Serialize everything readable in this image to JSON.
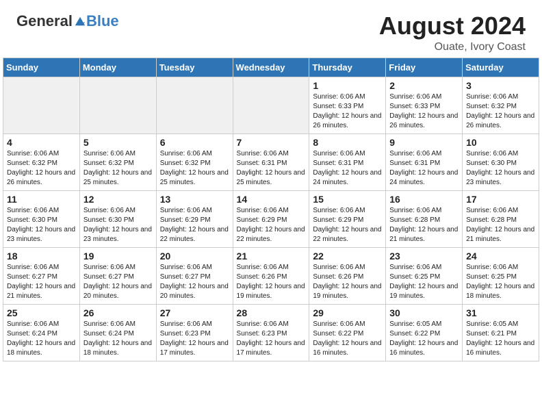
{
  "header": {
    "logo": {
      "general": "General",
      "blue": "Blue"
    },
    "title": "August 2024",
    "subtitle": "Ouate, Ivory Coast"
  },
  "days_of_week": [
    "Sunday",
    "Monday",
    "Tuesday",
    "Wednesday",
    "Thursday",
    "Friday",
    "Saturday"
  ],
  "weeks": [
    [
      {
        "day": "",
        "empty": true
      },
      {
        "day": "",
        "empty": true
      },
      {
        "day": "",
        "empty": true
      },
      {
        "day": "",
        "empty": true
      },
      {
        "day": "1",
        "sunrise": "Sunrise: 6:06 AM",
        "sunset": "Sunset: 6:33 PM",
        "daylight": "Daylight: 12 hours and 26 minutes."
      },
      {
        "day": "2",
        "sunrise": "Sunrise: 6:06 AM",
        "sunset": "Sunset: 6:33 PM",
        "daylight": "Daylight: 12 hours and 26 minutes."
      },
      {
        "day": "3",
        "sunrise": "Sunrise: 6:06 AM",
        "sunset": "Sunset: 6:32 PM",
        "daylight": "Daylight: 12 hours and 26 minutes."
      }
    ],
    [
      {
        "day": "4",
        "sunrise": "Sunrise: 6:06 AM",
        "sunset": "Sunset: 6:32 PM",
        "daylight": "Daylight: 12 hours and 26 minutes."
      },
      {
        "day": "5",
        "sunrise": "Sunrise: 6:06 AM",
        "sunset": "Sunset: 6:32 PM",
        "daylight": "Daylight: 12 hours and 25 minutes."
      },
      {
        "day": "6",
        "sunrise": "Sunrise: 6:06 AM",
        "sunset": "Sunset: 6:32 PM",
        "daylight": "Daylight: 12 hours and 25 minutes."
      },
      {
        "day": "7",
        "sunrise": "Sunrise: 6:06 AM",
        "sunset": "Sunset: 6:31 PM",
        "daylight": "Daylight: 12 hours and 25 minutes."
      },
      {
        "day": "8",
        "sunrise": "Sunrise: 6:06 AM",
        "sunset": "Sunset: 6:31 PM",
        "daylight": "Daylight: 12 hours and 24 minutes."
      },
      {
        "day": "9",
        "sunrise": "Sunrise: 6:06 AM",
        "sunset": "Sunset: 6:31 PM",
        "daylight": "Daylight: 12 hours and 24 minutes."
      },
      {
        "day": "10",
        "sunrise": "Sunrise: 6:06 AM",
        "sunset": "Sunset: 6:30 PM",
        "daylight": "Daylight: 12 hours and 23 minutes."
      }
    ],
    [
      {
        "day": "11",
        "sunrise": "Sunrise: 6:06 AM",
        "sunset": "Sunset: 6:30 PM",
        "daylight": "Daylight: 12 hours and 23 minutes."
      },
      {
        "day": "12",
        "sunrise": "Sunrise: 6:06 AM",
        "sunset": "Sunset: 6:30 PM",
        "daylight": "Daylight: 12 hours and 23 minutes."
      },
      {
        "day": "13",
        "sunrise": "Sunrise: 6:06 AM",
        "sunset": "Sunset: 6:29 PM",
        "daylight": "Daylight: 12 hours and 22 minutes."
      },
      {
        "day": "14",
        "sunrise": "Sunrise: 6:06 AM",
        "sunset": "Sunset: 6:29 PM",
        "daylight": "Daylight: 12 hours and 22 minutes."
      },
      {
        "day": "15",
        "sunrise": "Sunrise: 6:06 AM",
        "sunset": "Sunset: 6:29 PM",
        "daylight": "Daylight: 12 hours and 22 minutes."
      },
      {
        "day": "16",
        "sunrise": "Sunrise: 6:06 AM",
        "sunset": "Sunset: 6:28 PM",
        "daylight": "Daylight: 12 hours and 21 minutes."
      },
      {
        "day": "17",
        "sunrise": "Sunrise: 6:06 AM",
        "sunset": "Sunset: 6:28 PM",
        "daylight": "Daylight: 12 hours and 21 minutes."
      }
    ],
    [
      {
        "day": "18",
        "sunrise": "Sunrise: 6:06 AM",
        "sunset": "Sunset: 6:27 PM",
        "daylight": "Daylight: 12 hours and 21 minutes."
      },
      {
        "day": "19",
        "sunrise": "Sunrise: 6:06 AM",
        "sunset": "Sunset: 6:27 PM",
        "daylight": "Daylight: 12 hours and 20 minutes."
      },
      {
        "day": "20",
        "sunrise": "Sunrise: 6:06 AM",
        "sunset": "Sunset: 6:27 PM",
        "daylight": "Daylight: 12 hours and 20 minutes."
      },
      {
        "day": "21",
        "sunrise": "Sunrise: 6:06 AM",
        "sunset": "Sunset: 6:26 PM",
        "daylight": "Daylight: 12 hours and 19 minutes."
      },
      {
        "day": "22",
        "sunrise": "Sunrise: 6:06 AM",
        "sunset": "Sunset: 6:26 PM",
        "daylight": "Daylight: 12 hours and 19 minutes."
      },
      {
        "day": "23",
        "sunrise": "Sunrise: 6:06 AM",
        "sunset": "Sunset: 6:25 PM",
        "daylight": "Daylight: 12 hours and 19 minutes."
      },
      {
        "day": "24",
        "sunrise": "Sunrise: 6:06 AM",
        "sunset": "Sunset: 6:25 PM",
        "daylight": "Daylight: 12 hours and 18 minutes."
      }
    ],
    [
      {
        "day": "25",
        "sunrise": "Sunrise: 6:06 AM",
        "sunset": "Sunset: 6:24 PM",
        "daylight": "Daylight: 12 hours and 18 minutes."
      },
      {
        "day": "26",
        "sunrise": "Sunrise: 6:06 AM",
        "sunset": "Sunset: 6:24 PM",
        "daylight": "Daylight: 12 hours and 18 minutes."
      },
      {
        "day": "27",
        "sunrise": "Sunrise: 6:06 AM",
        "sunset": "Sunset: 6:23 PM",
        "daylight": "Daylight: 12 hours and 17 minutes."
      },
      {
        "day": "28",
        "sunrise": "Sunrise: 6:06 AM",
        "sunset": "Sunset: 6:23 PM",
        "daylight": "Daylight: 12 hours and 17 minutes."
      },
      {
        "day": "29",
        "sunrise": "Sunrise: 6:06 AM",
        "sunset": "Sunset: 6:22 PM",
        "daylight": "Daylight: 12 hours and 16 minutes."
      },
      {
        "day": "30",
        "sunrise": "Sunrise: 6:05 AM",
        "sunset": "Sunset: 6:22 PM",
        "daylight": "Daylight: 12 hours and 16 minutes."
      },
      {
        "day": "31",
        "sunrise": "Sunrise: 6:05 AM",
        "sunset": "Sunset: 6:21 PM",
        "daylight": "Daylight: 12 hours and 16 minutes."
      }
    ]
  ]
}
